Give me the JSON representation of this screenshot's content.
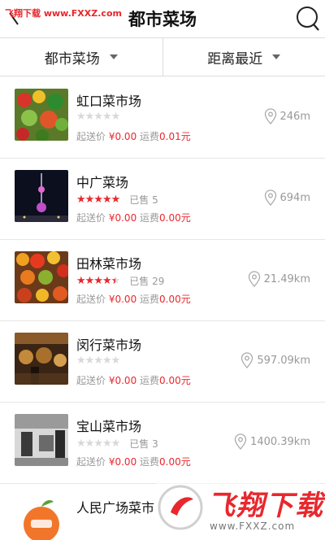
{
  "header": {
    "watermark": "飞翔下载 www.FXXZ.com",
    "title": "都市菜场",
    "icons": {
      "back": "back-arrow-icon",
      "search": "search-icon"
    }
  },
  "filters": [
    {
      "label": "都市菜场"
    },
    {
      "label": "距离最近"
    }
  ],
  "labels": {
    "min_order": "起送价",
    "delivery_fee": "运费",
    "sold_prefix": "已售"
  },
  "colors": {
    "accent": "#e8282e",
    "text": "#111111",
    "muted": "#999999",
    "divider": "#e6e6e6"
  },
  "markets": [
    {
      "name": "虹口菜市场",
      "rating": 0,
      "sold": "",
      "min_price": "¥0.00",
      "fee": "0.01元",
      "distance": "246m"
    },
    {
      "name": "中广菜场",
      "rating": 5,
      "sold": "已售 5",
      "min_price": "¥0.00",
      "fee": "0.00元",
      "distance": "694m"
    },
    {
      "name": "田林菜市场",
      "rating": 4.5,
      "sold": "已售 29",
      "min_price": "¥0.00",
      "fee": "0.00元",
      "distance": "21.49km"
    },
    {
      "name": "闵行菜市场",
      "rating": 0,
      "sold": "",
      "min_price": "¥0.00",
      "fee": "0.00元",
      "distance": "597.09km"
    },
    {
      "name": "宝山菜市场",
      "rating": 0,
      "sold": "已售 3",
      "min_price": "¥0.00",
      "fee": "0.00元",
      "distance": "1400.39km"
    },
    {
      "name": "人民广场菜市",
      "rating": 0,
      "sold": "",
      "min_price": "",
      "fee": "",
      "distance": ""
    }
  ],
  "watermark_bottom": {
    "text": "飞翔下载",
    "url": "www.FXXZ.com"
  }
}
